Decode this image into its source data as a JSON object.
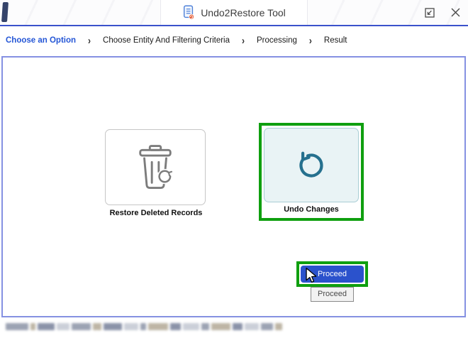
{
  "window": {
    "title": "Undo2Restore Tool"
  },
  "breadcrumb": {
    "separator": "›",
    "steps": [
      {
        "label": "Choose an Option",
        "active": true
      },
      {
        "label": "Choose Entity And Filtering Criteria",
        "active": false
      },
      {
        "label": "Processing",
        "active": false
      },
      {
        "label": "Result",
        "active": false
      }
    ]
  },
  "options": [
    {
      "label": "Restore Deleted Records",
      "icon": "trash-restore-icon",
      "selected": false,
      "highlighted": false
    },
    {
      "label": "Undo Changes",
      "icon": "undo-circular-arrow-icon",
      "selected": true,
      "highlighted": true
    }
  ],
  "proceed": {
    "label": "Proceed",
    "tooltip": "Proceed",
    "highlighted": true
  },
  "status_bar": {
    "redacted": true
  },
  "icons": {
    "titlebar": "document-icon",
    "window_restore": "restore-window-icon",
    "window_close": "close-icon",
    "pointer": "mouse-cursor-icon"
  },
  "colors": {
    "highlight_green": "#0f9f0f",
    "proceed_button_blue": "#2b52cc",
    "active_step_blue": "#2456d6",
    "titlebar_accent_blue": "#3b52cb",
    "panel_border_blue": "#8591e2",
    "undo_icon_teal": "#25708e",
    "undo_card_bg": "#e9f3f5",
    "trash_icon_gray": "#7c7c7c"
  }
}
